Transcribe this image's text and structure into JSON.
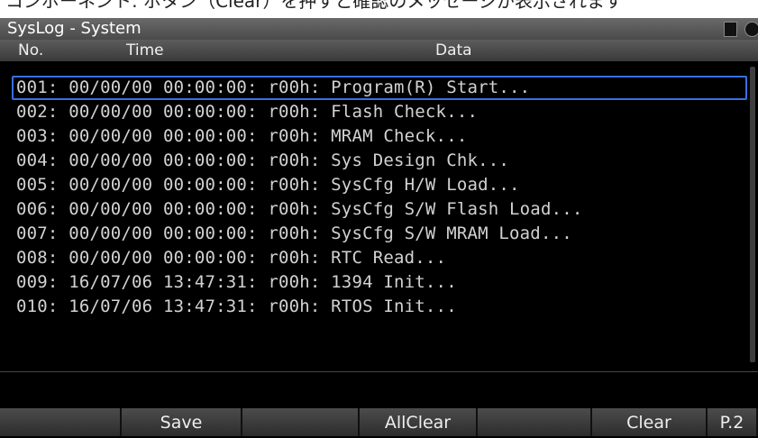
{
  "caption": "コンポーネント: ボタン（Clear）を押すと確認のメッセージが表示されます",
  "window": {
    "title": "SysLog - System"
  },
  "columns": {
    "no": "No.",
    "time": "Time",
    "data": "Data"
  },
  "log": [
    {
      "no": "001",
      "time": "00/00/00 00:00:00",
      "reg": "r00h",
      "msg": "Program(R) Start..."
    },
    {
      "no": "002",
      "time": "00/00/00 00:00:00",
      "reg": "r00h",
      "msg": "Flash Check..."
    },
    {
      "no": "003",
      "time": "00/00/00 00:00:00",
      "reg": "r00h",
      "msg": "MRAM Check..."
    },
    {
      "no": "004",
      "time": "00/00/00 00:00:00",
      "reg": "r00h",
      "msg": "Sys Design Chk..."
    },
    {
      "no": "005",
      "time": "00/00/00 00:00:00",
      "reg": "r00h",
      "msg": "SysCfg H/W Load..."
    },
    {
      "no": "006",
      "time": "00/00/00 00:00:00",
      "reg": "r00h",
      "msg": "SysCfg S/W Flash Load..."
    },
    {
      "no": "007",
      "time": "00/00/00 00:00:00",
      "reg": "r00h",
      "msg": "SysCfg S/W MRAM Load..."
    },
    {
      "no": "008",
      "time": "00/00/00 00:00:00",
      "reg": "r00h",
      "msg": "RTC Read..."
    },
    {
      "no": "009",
      "time": "16/07/06 13:47:31",
      "reg": "r00h",
      "msg": "1394 Init..."
    },
    {
      "no": "010",
      "time": "16/07/06 13:47:31",
      "reg": "r00h",
      "msg": "RTOS Init..."
    }
  ],
  "function_keys": {
    "f1": "",
    "f2": "Save",
    "f3": "",
    "f4": "AllClear",
    "f5": "",
    "f6": "Clear",
    "f7": "P.2"
  },
  "colors": {
    "selection": "#3a6fe0",
    "background": "#000000"
  }
}
